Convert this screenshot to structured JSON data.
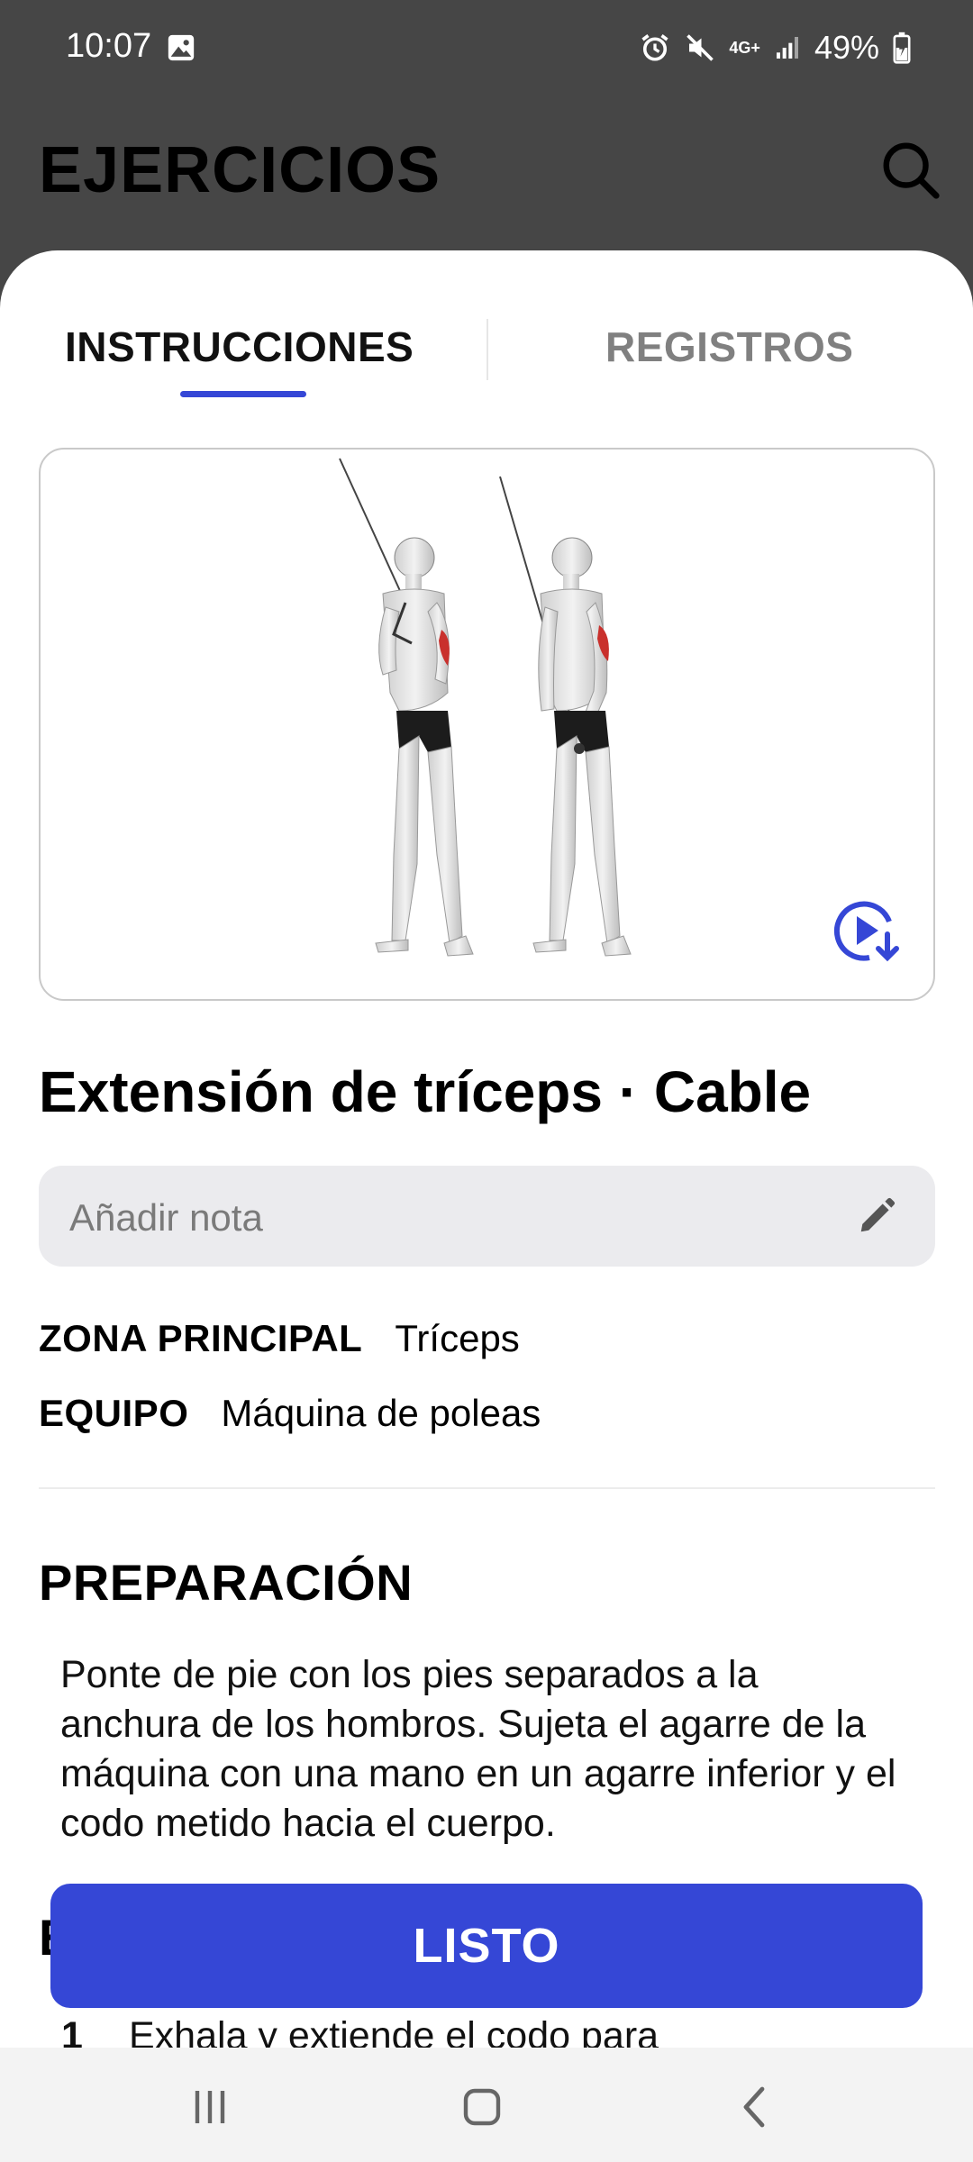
{
  "status_bar": {
    "time": "10:07",
    "battery": "49%",
    "network": "4G+"
  },
  "header": {
    "title": "EJERCICIOS"
  },
  "tabs": [
    {
      "label": "INSTRUCCIONES",
      "active": true
    },
    {
      "label": "REGISTROS",
      "active": false
    }
  ],
  "exercise": {
    "title": "Extensión de tríceps · Cable",
    "note_placeholder": "Añadir nota",
    "meta": [
      {
        "label": "ZONA PRINCIPAL",
        "value": "Tríceps"
      },
      {
        "label": "EQUIPO",
        "value": "Máquina de poleas"
      }
    ]
  },
  "preparation": {
    "heading": "PREPARACIÓN",
    "text": "Ponte de pie con los pies separados a la anchura de los hombros. Sujeta el agarre de la máquina con una mano en un agarre inferior y el codo metido hacia el cuerpo."
  },
  "execution": {
    "heading_visible": "E",
    "step_number": "1",
    "step_text": "Exhala y extiende el codo para"
  },
  "done_button": {
    "label": "LISTO"
  },
  "colors": {
    "accent": "#3547d6",
    "header_bg": "#464646",
    "muscle_highlight": "#c9302c"
  },
  "icons": {
    "search": "search-icon",
    "video_download": "video-download-icon",
    "pencil": "pencil-icon",
    "nav_recent": "recent-apps-icon",
    "nav_home": "home-icon",
    "nav_back": "back-icon"
  }
}
